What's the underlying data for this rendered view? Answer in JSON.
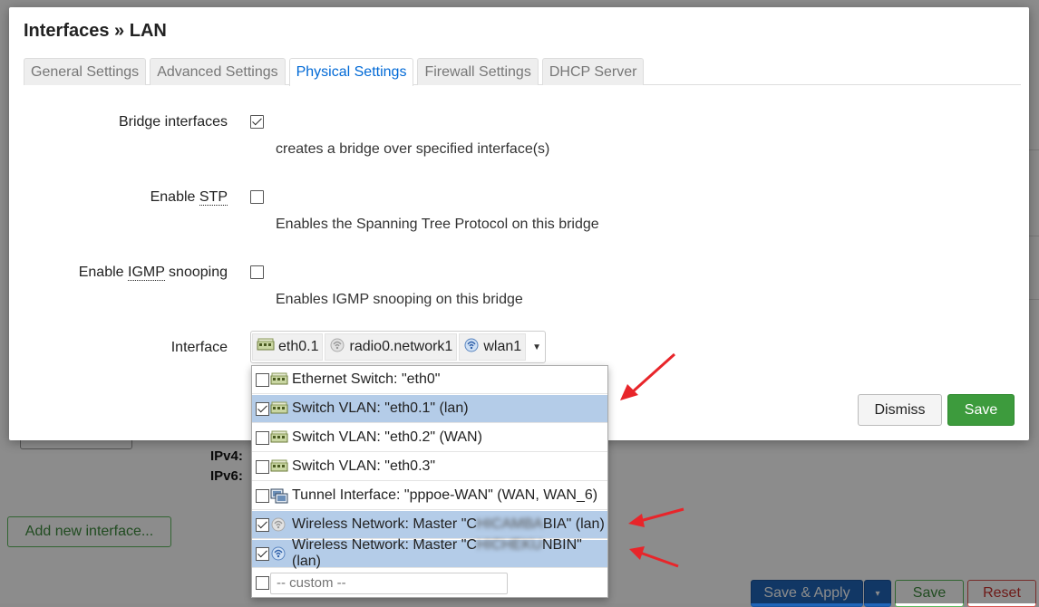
{
  "modal": {
    "title": "Interfaces » LAN",
    "tabs": [
      {
        "label": "General Settings",
        "active": false
      },
      {
        "label": "Advanced Settings",
        "active": false
      },
      {
        "label": "Physical Settings",
        "active": true
      },
      {
        "label": "Firewall Settings",
        "active": false
      },
      {
        "label": "DHCP Server",
        "active": false
      }
    ],
    "bridge": {
      "label": "Bridge interfaces",
      "checked": true,
      "desc": "creates a bridge over specified interface(s)"
    },
    "stp": {
      "label_prefix": "Enable ",
      "label_abbr": "STP",
      "checked": false,
      "desc": "Enables the Spanning Tree Protocol on this bridge"
    },
    "igmp": {
      "label_prefix": "Enable ",
      "label_abbr": "IGMP",
      "label_suffix": " snooping",
      "checked": false,
      "desc": "Enables IGMP snooping on this bridge"
    },
    "interface": {
      "label": "Interface",
      "chips": [
        {
          "label": "eth0.1",
          "icon": "switch-icon"
        },
        {
          "label": "radio0.network1",
          "icon": "wireless-disabled-icon"
        },
        {
          "label": "wlan1",
          "icon": "wireless-icon"
        }
      ]
    },
    "dismiss_label": "Dismiss",
    "save_label": "Save"
  },
  "dropdown": {
    "options": [
      {
        "label": "Ethernet Switch: \"eth0\"",
        "checked": false,
        "icon": "switch-icon"
      },
      {
        "label": "Switch VLAN: \"eth0.1\" (lan)",
        "checked": true,
        "icon": "switch-icon"
      },
      {
        "label": "Switch VLAN: \"eth0.2\" (WAN)",
        "checked": false,
        "icon": "switch-icon"
      },
      {
        "label": "Switch VLAN: \"eth0.3\"",
        "checked": false,
        "icon": "switch-icon"
      },
      {
        "label": "Tunnel Interface: \"pppoe-WAN\" (WAN, WAN_6)",
        "checked": false,
        "icon": "tunnel-icon"
      },
      {
        "label_pre": "Wireless Network: Master \"C",
        "label_blur": "HICAMBA",
        "label_post": "BIA\" (lan)",
        "checked": true,
        "icon": "wireless-disabled-icon"
      },
      {
        "label_pre": "Wireless Network: Master \"C",
        "label_blur": "HICHEKU",
        "label_post": "NBIN\" (lan)",
        "checked": true,
        "icon": "wireless-icon"
      }
    ],
    "custom_placeholder": "-- custom --"
  },
  "background": {
    "add_interface_label": "Add new interface...",
    "ipv4_label": "IPv4:",
    "ipv6_label": "IPv6:",
    "save_apply_label": "Save & Apply",
    "save_label": "Save",
    "reset_label": "Reset"
  }
}
